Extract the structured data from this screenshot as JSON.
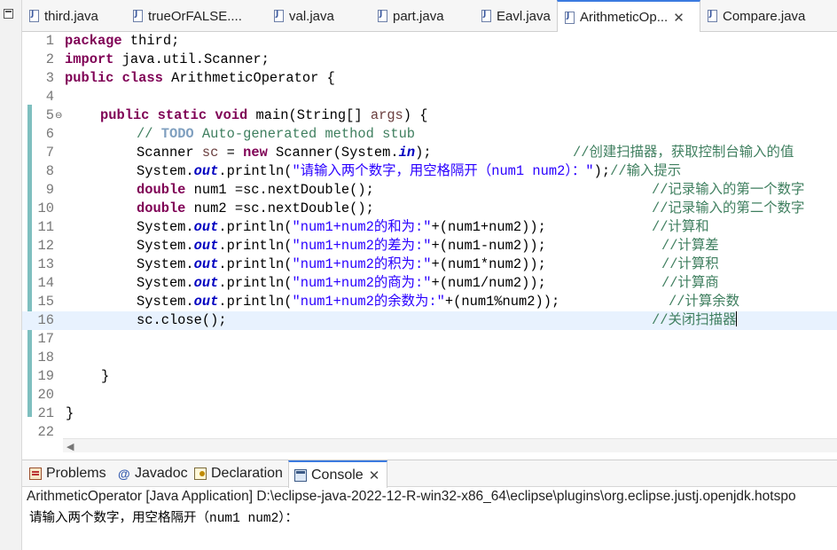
{
  "minimize_icon": "minimize-icon",
  "editor_tabs": [
    {
      "label": "third.java",
      "active": false
    },
    {
      "label": "trueOrFALSE....",
      "active": false
    },
    {
      "label": "val.java",
      "active": false
    },
    {
      "label": "part.java",
      "active": false
    },
    {
      "label": "Eavl.java",
      "active": false
    },
    {
      "label": "ArithmeticOp...",
      "active": true,
      "close": "✕"
    },
    {
      "label": "Compare.java",
      "active": false
    }
  ],
  "code": {
    "line_numbers": [
      "1",
      "2",
      "3",
      "4",
      "5",
      "6",
      "7",
      "8",
      "9",
      "10",
      "11",
      "12",
      "13",
      "14",
      "15",
      "16",
      "17",
      "18",
      "19",
      "20",
      "21",
      "22"
    ],
    "l1": {
      "kw": "package",
      "rest": " third;"
    },
    "l2": {
      "kw": "import",
      "rest": " java.util.Scanner;"
    },
    "l3": {
      "kw1": "public",
      "kw2": "class",
      "rest": " ArithmeticOperator {"
    },
    "l5": {
      "kw1": "public",
      "kw2": "static",
      "kw3": "void",
      "name": " main(String[] ",
      "param": "args",
      "end": ") {",
      "marker": "⊖"
    },
    "l6": {
      "pre": "// ",
      "todo": "TODO",
      "post": " Auto-generated method stub"
    },
    "l7": {
      "a": "Scanner ",
      "var": "sc",
      "b": " = ",
      "kw": "new",
      "c": " Scanner(System.",
      "fld": "in",
      "d": ");",
      "comment": "//创建扫描器，获取控制台输入的值"
    },
    "l8": {
      "a": "System.",
      "fld": "out",
      "b": ".println(",
      "str": "\"请输入两个数字，用空格隔开（num1 num2）：\"",
      "c": ");",
      "comment": "//输入提示"
    },
    "l9": {
      "kw": "double",
      "a": " num1 =sc.nextDouble();",
      "comment": "//记录输入的第一个数字"
    },
    "l10": {
      "kw": "double",
      "a": " num2 =sc.nextDouble();",
      "comment": "//记录输入的第二个数字"
    },
    "l11": {
      "a": "System.",
      "fld": "out",
      "b": ".println(",
      "str": "\"num1+num2的和为:\"",
      "c": "+(num1+num2));",
      "comment": "//计算和"
    },
    "l12": {
      "a": "System.",
      "fld": "out",
      "b": ".println(",
      "str": "\"num1+num2的差为:\"",
      "c": "+(num1-num2));",
      "comment": "//计算差"
    },
    "l13": {
      "a": "System.",
      "fld": "out",
      "b": ".println(",
      "str": "\"num1+num2的积为:\"",
      "c": "+(num1*num2));",
      "comment": "//计算积"
    },
    "l14": {
      "a": "System.",
      "fld": "out",
      "b": ".println(",
      "str": "\"num1+num2的商为:\"",
      "c": "+(num1/num2));",
      "comment": "//计算商"
    },
    "l15": {
      "a": "System.",
      "fld": "out",
      "b": ".println(",
      "str": "\"num1+num2的余数为:\"",
      "c": "+(num1%num2));",
      "comment": "//计算余数"
    },
    "l16": {
      "a": "sc.close();",
      "comment": "//关闭扫描器"
    },
    "l19": {
      "a": "}"
    },
    "l21": {
      "a": "}"
    }
  },
  "panel": {
    "tabs": [
      {
        "label": "Problems",
        "icon": "problems-icon"
      },
      {
        "label": "Javadoc",
        "icon": "at-sign-icon",
        "glyph": "@"
      },
      {
        "label": "Declaration",
        "icon": "declaration-icon"
      },
      {
        "label": "Console",
        "icon": "console-icon",
        "active": true,
        "close": "✕"
      }
    ],
    "console_header": "ArithmeticOperator [Java Application] D:\\eclipse-java-2022-12-R-win32-x86_64\\eclipse\\plugins\\org.eclipse.justj.openjdk.hotspo",
    "console_output": "请输入两个数字，用空格隔开（num1 num2）："
  }
}
